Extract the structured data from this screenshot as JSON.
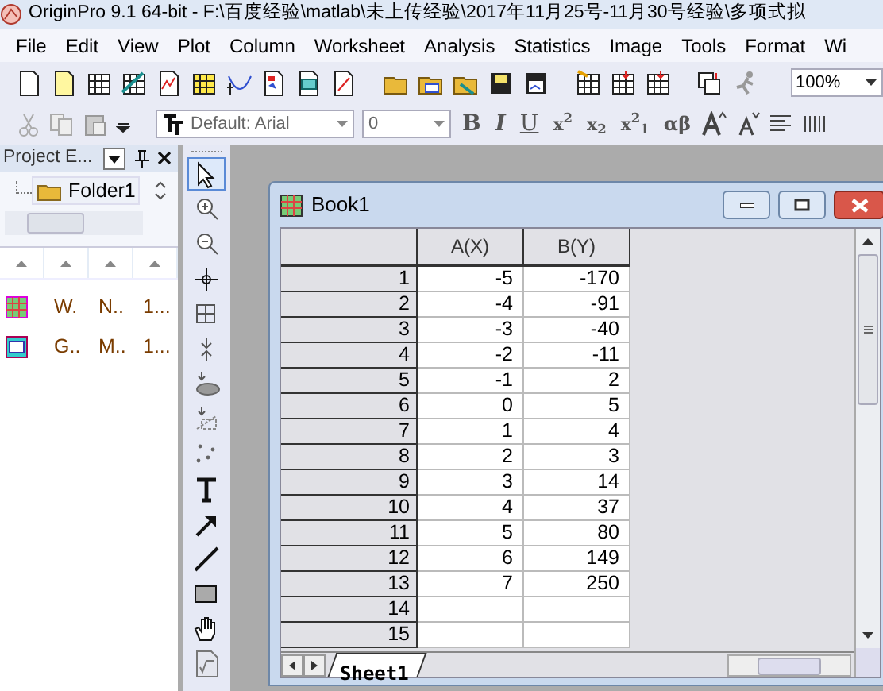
{
  "window": {
    "title": "OriginPro 9.1 64-bit - F:\\百度经验\\matlab\\未上传经验\\2017年11月25号-11月30号经验\\多项式拟"
  },
  "menu": [
    "File",
    "Edit",
    "View",
    "Plot",
    "Column",
    "Worksheet",
    "Analysis",
    "Statistics",
    "Image",
    "Tools",
    "Format",
    "Wi"
  ],
  "zoom_combo": {
    "value": "100%"
  },
  "font_combo": {
    "value": "Default: Arial"
  },
  "size_combo": {
    "value": "0"
  },
  "format_buttons": [
    "B",
    "I",
    "U",
    "x$^{2}$",
    "x$_{2}$",
    "x$^{2}$$_{1}$",
    "αβ"
  ],
  "project_explorer": {
    "title": "Project E...",
    "folder": "Folder1",
    "items": [
      {
        "kind": "workbook",
        "cells": [
          "W.",
          "N..",
          "1..."
        ]
      },
      {
        "kind": "graph",
        "cells": [
          "G..",
          "M..",
          "1..."
        ]
      }
    ]
  },
  "tools": [
    {
      "kind": "pointer",
      "selected": true
    },
    {
      "kind": "zoom-in",
      "selected": false
    },
    {
      "kind": "zoom-out",
      "selected": false
    },
    {
      "kind": "crosshair",
      "selected": false
    },
    {
      "kind": "screen-reader",
      "selected": false
    },
    {
      "kind": "mask",
      "selected": false
    },
    {
      "kind": "data-selector",
      "selected": false
    },
    {
      "kind": "region",
      "selected": false
    },
    {
      "kind": "scatter",
      "selected": false
    },
    {
      "kind": "text",
      "selected": false
    },
    {
      "kind": "arrow",
      "selected": false
    },
    {
      "kind": "line",
      "selected": false
    },
    {
      "kind": "rectangle",
      "selected": false
    },
    {
      "kind": "hand",
      "selected": false
    },
    {
      "kind": "equation",
      "selected": false
    }
  ],
  "workbook": {
    "title": "Book1",
    "columns": [
      "A(X)",
      "B(Y)"
    ],
    "rows": [
      {
        "label": "1",
        "cells": [
          "-5",
          "-170"
        ]
      },
      {
        "label": "2",
        "cells": [
          "-4",
          "-91"
        ]
      },
      {
        "label": "3",
        "cells": [
          "-3",
          "-40"
        ]
      },
      {
        "label": "4",
        "cells": [
          "-2",
          "-11"
        ]
      },
      {
        "label": "5",
        "cells": [
          "-1",
          "2"
        ]
      },
      {
        "label": "6",
        "cells": [
          "0",
          "5"
        ]
      },
      {
        "label": "7",
        "cells": [
          "1",
          "4"
        ]
      },
      {
        "label": "8",
        "cells": [
          "2",
          "3"
        ]
      },
      {
        "label": "9",
        "cells": [
          "3",
          "14"
        ]
      },
      {
        "label": "10",
        "cells": [
          "4",
          "37"
        ]
      },
      {
        "label": "11",
        "cells": [
          "5",
          "80"
        ]
      },
      {
        "label": "12",
        "cells": [
          "6",
          "149"
        ]
      },
      {
        "label": "13",
        "cells": [
          "7",
          "250"
        ]
      },
      {
        "label": "14"
      },
      {
        "label": "15"
      }
    ],
    "sheets": [
      {
        "label": "Sheet1",
        "selected": true
      }
    ]
  }
}
